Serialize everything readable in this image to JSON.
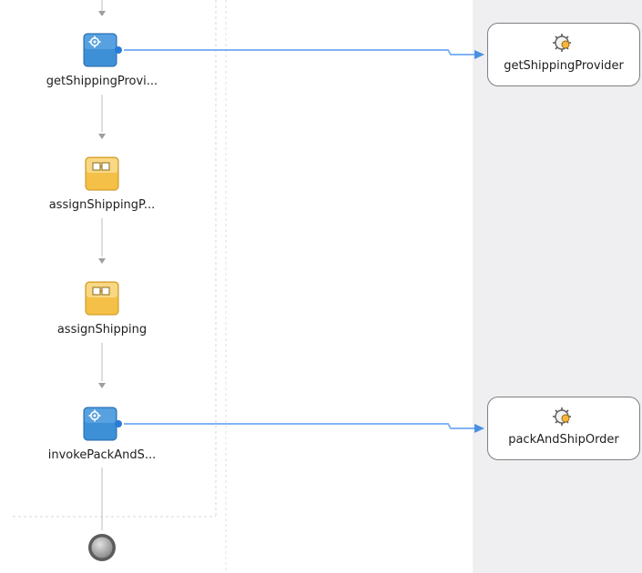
{
  "activities": [
    {
      "label": "getShippingProvi...",
      "type": "invoke"
    },
    {
      "label": "assignShippingP...",
      "type": "assign"
    },
    {
      "label": "assignShipping",
      "type": "assign"
    },
    {
      "label": "invokePackAndS...",
      "type": "invoke"
    }
  ],
  "partner_links": [
    {
      "label": "getShippingProvider"
    },
    {
      "label": "packAndShipOrder"
    }
  ],
  "connections": [
    {
      "from": "getShippingProvi...",
      "to": "getShippingProvider"
    },
    {
      "from": "invokePackAndS...",
      "to": "packAndShipOrder"
    }
  ],
  "colors": {
    "invoke": "#3d8fd6",
    "assign": "#f4c048",
    "connector": "#7fb3f5",
    "flow_line": "#bdbdbd",
    "end_node": "#9a9a9a",
    "partner_lane": "#efeff2"
  },
  "icons": {
    "invoke": "gear-icon",
    "assign": "assign-icon",
    "partner": "service-gear-icon",
    "end": "end-event-icon"
  }
}
